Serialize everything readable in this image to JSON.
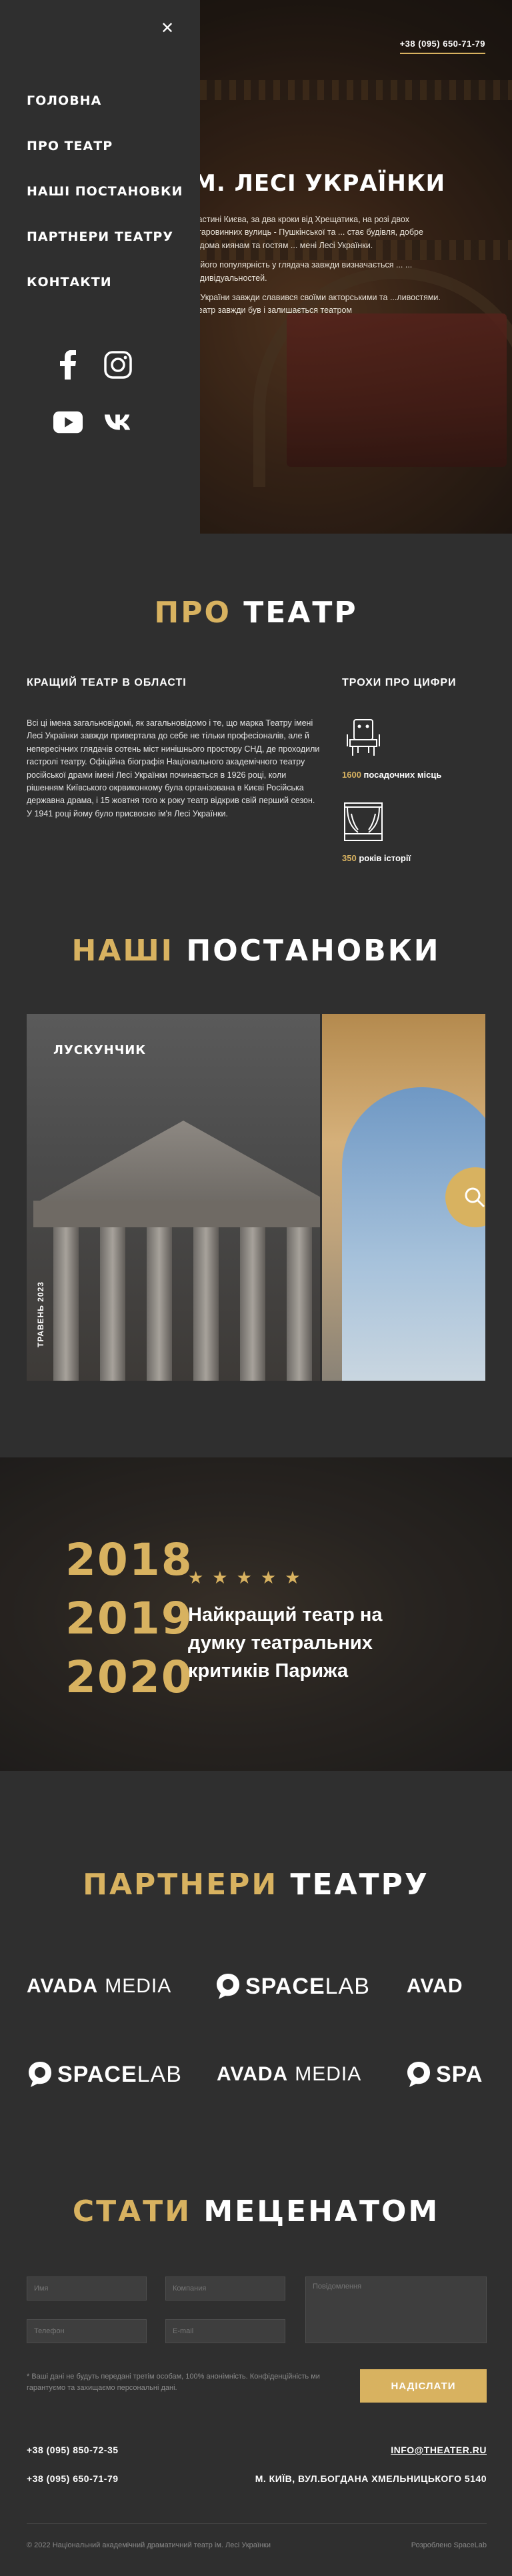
{
  "header": {
    "phone": "+38 (095) 650-71-79",
    "hero_title": "М. ЛЕСІ УКРАЇНКИ",
    "hero_paragraphs": [
      "частині Києва, за два кроки від Хрещатика, на розі двох старовинних вулиць - Пушкінської та ... стає будівля, добре відома киянам та гостям ... мені Лесі Українки.",
      "...його популярність у глядача завжди визначається ... ... індивідуальностей.",
      "...України завжди славився своїми акторськими та ...ливостями. Театр завжди був і залишається театром"
    ]
  },
  "menu": {
    "items": [
      "ГОЛОВНА",
      "ПРО ТЕАТР",
      "НАШІ ПОСТАНОВКИ",
      "ПАРТНЕРИ ТЕАТРУ",
      "КОНТАКТИ"
    ],
    "socials": [
      "facebook-icon",
      "instagram-icon",
      "youtube-icon",
      "vk-icon"
    ]
  },
  "about": {
    "title_accent": "ПРО",
    "title_rest": "ТЕАТР",
    "subtitle": "КРАЩИЙ ТЕАТР В ОБЛАСТІ",
    "text": "Всі ці імена загальновідомі, як загальновідомо і те, що марка Театру імені Лесі Українки завжди привертала до себе не тільки професіоналів, але й непересічних глядачів сотень міст нинішнього простору СНД, де проходили гастролі театру. Офіційна біографія Національного академічного театру російської драми імені Лесі Українки починається в 1926 році, коли рішенням Київського окрвиконкому була організована в Києві Російська державна драма, і 15 жовтня того ж року театр відкрив свій перший сезон. У 1941 році йому було присвоєно ім'я Лесі Українки.",
    "stats_title": "ТРОХИ ПРО ЦИФРИ",
    "stats": [
      {
        "icon": "theater-seat-icon",
        "number": "1600",
        "label": "посадочних місць"
      },
      {
        "icon": "stage-curtain-icon",
        "number": "350",
        "label": "років історії"
      }
    ]
  },
  "shows": {
    "title_accent": "НАШІ",
    "title_rest": "ПОСТАНОВКИ",
    "featured": {
      "name": "ЛУСКУНЧИК",
      "date": "ТРАВЕНЬ 2023"
    }
  },
  "award": {
    "years": [
      "2018",
      "2019",
      "2020"
    ],
    "stars": "★★★★★",
    "text": "Найкращий театр на думку театральних критиків Парижа"
  },
  "partners": {
    "title_accent": "ПАРТНЕРИ",
    "title_rest": "ТЕАТРУ",
    "avada_bold": "AVADA",
    "avada_light": "MEDIA",
    "space_bold": "SPACE",
    "space_light": "LAB",
    "avada_cut": "AVAD",
    "space_cut": "SPA"
  },
  "patrons": {
    "title_accent": "СТАТИ",
    "title_rest": "МЕЦЕНАТОМ",
    "fields": {
      "name": "Имя",
      "company": "Компания",
      "message": "Повідомлення",
      "phone": "Телефон",
      "email": "E-mail"
    },
    "note": "* Ваші дані не будуть передані третім особам, 100% анонімність. Конфіденційність ми гарантуємо та захищаємо персональні дані.",
    "submit": "НАДІСЛАТИ"
  },
  "footer": {
    "phone1": "+38 (095) 850-72-35",
    "phone2": "+38 (095) 650-71-79",
    "email": "INFO@THEATER.RU",
    "address": "М. КИЇВ, ВУЛ.БОГДАНА ХМЕЛЬНИЦЬКОГО 5140",
    "copyright": "© 2022 Національний академічний драматичний театр ім. Лесі Українки",
    "made_by": "Розроблено SpaceLab"
  },
  "colors": {
    "accent": "#d8b260",
    "background": "#2f2f2f",
    "field": "#3e3e3e"
  }
}
